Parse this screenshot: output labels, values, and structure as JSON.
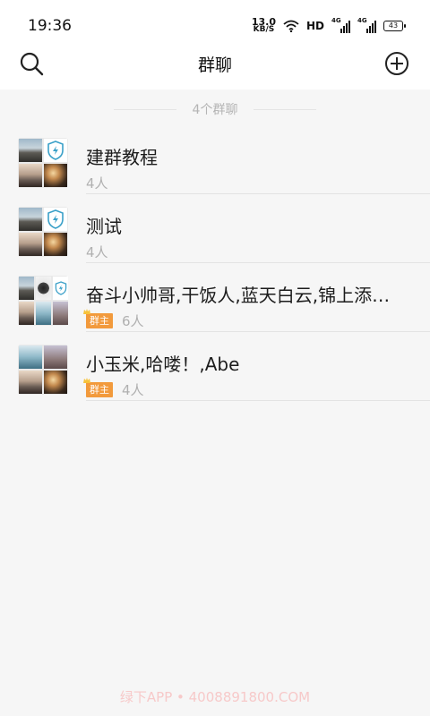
{
  "status_bar": {
    "time": "19:36",
    "net_speed_value": "13.0",
    "net_speed_unit": "KB/S",
    "hd_label": "HD",
    "sim1_label": "4G",
    "sim2_label": "4G",
    "battery_level": "43"
  },
  "header": {
    "title": "群聊",
    "search_icon": "search-icon",
    "add_icon": "add-circle-icon"
  },
  "list": {
    "count_text": "4个群聊",
    "groups": [
      {
        "name": "建群教程",
        "members": "4人",
        "badge": ""
      },
      {
        "name": "测试",
        "members": "4人",
        "badge": ""
      },
      {
        "name": "奋斗小帅哥,干饭人,蓝天白云,锦上添…",
        "members": "6人",
        "badge": "群主"
      },
      {
        "name": "小玉米,哈喽！,Abe",
        "members": "4人",
        "badge": "群主"
      }
    ]
  },
  "watermark": "绿下APP • 4008891800.COM",
  "colors": {
    "badge": "#f29a3c",
    "background": "#f6f6f6",
    "shield_accent": "#3aa0c8"
  }
}
